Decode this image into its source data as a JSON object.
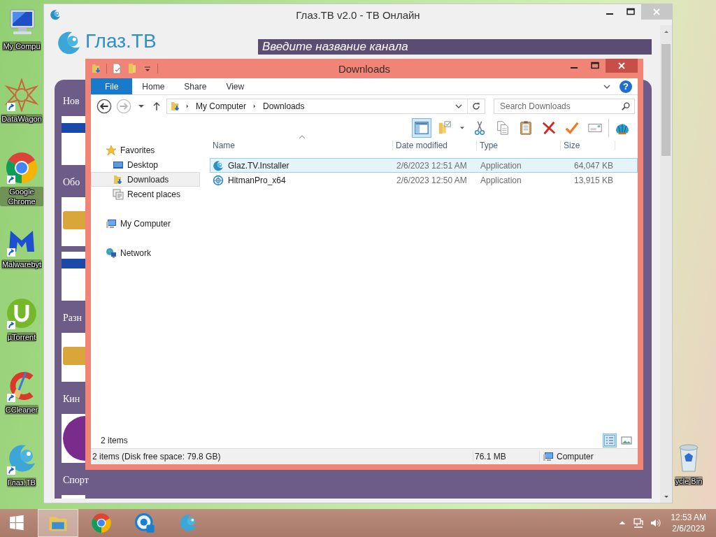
{
  "desktop": {
    "icons_left": [
      {
        "kind": "computer",
        "label": "My Compu",
        "shortcut": false
      },
      {
        "kind": "ornament",
        "label": "DataWagon",
        "shortcut": true
      },
      {
        "kind": "browser",
        "label": "Google Chrome",
        "shortcut": true
      },
      {
        "kind": "m-logo",
        "label": "Malwarebyt",
        "shortcut": true
      },
      {
        "kind": "u-logo",
        "label": "µTorrent",
        "shortcut": true
      },
      {
        "kind": "c-logo",
        "label": "CCleaner",
        "shortcut": true
      },
      {
        "kind": "eye-logo",
        "label": "Глаз.ТВ",
        "shortcut": true
      }
    ],
    "icons_right": [
      {
        "kind": "bin",
        "label": "ycle Bin",
        "shortcut": false
      }
    ]
  },
  "back_window": {
    "title": "Глаз.ТВ v2.0 - ТВ Онлайн",
    "logo_text": "Глаз.ТВ",
    "search_placeholder": "Введите название канала",
    "sections": [
      {
        "title": "Нов",
        "cards": [
          {
            "kind": "banner"
          }
        ]
      },
      {
        "title": "Обо",
        "cards": [
          {
            "kind": "emblem"
          },
          {
            "kind": "banner"
          }
        ]
      },
      {
        "title": "Разн",
        "cards": [
          {
            "kind": "emblem"
          }
        ]
      },
      {
        "title": "Кин",
        "cards": [
          {
            "kind": "round"
          }
        ]
      },
      {
        "title": "Спорт",
        "cards": [
          {
            "kind": "blank"
          }
        ]
      }
    ]
  },
  "explorer": {
    "title": "Downloads",
    "ribbon_tabs": [
      {
        "label": "File",
        "selected": true
      },
      {
        "label": "Home",
        "selected": false
      },
      {
        "label": "Share",
        "selected": false
      },
      {
        "label": "View",
        "selected": false
      }
    ],
    "help_label": "?",
    "forward_disabled": true,
    "address": [
      "My Computer",
      "Downloads"
    ],
    "search_placeholder": "Search Downloads",
    "toolbar": [
      {
        "kind": "pane",
        "selected": true
      },
      {
        "kind": "folder-check",
        "selected": false
      },
      {
        "kind": "cut",
        "selected": false
      },
      {
        "kind": "copy",
        "selected": false
      },
      {
        "kind": "paste",
        "selected": false
      },
      {
        "kind": "delete",
        "selected": false
      },
      {
        "kind": "check",
        "selected": false
      },
      {
        "kind": "card",
        "selected": false
      },
      {
        "kind": "shell",
        "selected": false
      }
    ],
    "navigation": [
      {
        "kind": "favorites",
        "label": "Favorites",
        "selected": false,
        "children": [
          {
            "kind": "desktop",
            "label": "Desktop",
            "selected": false
          },
          {
            "kind": "downloads",
            "label": "Downloads",
            "selected": true
          },
          {
            "kind": "recent",
            "label": "Recent places",
            "selected": false
          }
        ]
      },
      {
        "kind": "computer",
        "label": "My Computer",
        "selected": false
      },
      {
        "kind": "network",
        "label": "Network",
        "selected": false
      }
    ],
    "columns": [
      "Name",
      "Date modified",
      "Type",
      "Size"
    ],
    "rows": [
      {
        "kind": "eye",
        "name": "Glaz.TV.Installer",
        "date": "2/6/2023 12:51 AM",
        "type": "Application",
        "size": "64,047 KB",
        "selected": true
      },
      {
        "kind": "target",
        "name": "HitmanPro_x64",
        "date": "2/6/2023 12:50 AM",
        "type": "Application",
        "size": "13,915 KB",
        "selected": false
      }
    ],
    "item_count": "2 items",
    "views": [
      {
        "kind": "details",
        "selected": true
      },
      {
        "kind": "thumbnails",
        "selected": false
      }
    ],
    "status": {
      "summary": "2 items (Disk free space: 79.8 GB)",
      "size": "76.1 MB",
      "location": "Computer"
    }
  },
  "taskbar": {
    "tasks": [
      {
        "kind": "explorer",
        "selected": true
      },
      {
        "kind": "browser",
        "selected": false
      },
      {
        "kind": "target",
        "selected": false
      },
      {
        "kind": "eye",
        "selected": false
      }
    ],
    "time": "12:53 AM",
    "date": "2/6/2023"
  }
}
